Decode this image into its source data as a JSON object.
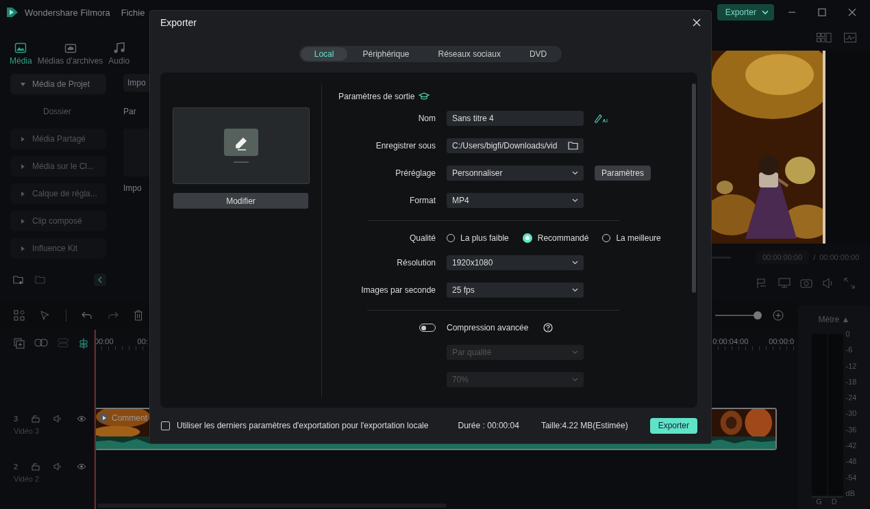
{
  "app": {
    "title": "Wondershare Filmora",
    "menu": [
      "Fichie"
    ],
    "export_button": "Exporter"
  },
  "media_tabs": [
    {
      "label": "Média",
      "selected": true
    },
    {
      "label": "Médias d'archives",
      "selected": false
    },
    {
      "label": "Audio",
      "selected": false
    }
  ],
  "sidebar": {
    "items": [
      {
        "label": "Média de Projet",
        "expanded": true,
        "children": [
          {
            "label": "Dossier"
          }
        ]
      },
      {
        "label": "Média Partagé",
        "expanded": false
      },
      {
        "label": "Média sur le Cl...",
        "expanded": false
      },
      {
        "label": "Calque de régla...",
        "expanded": false
      },
      {
        "label": "Clip composé",
        "expanded": false
      },
      {
        "label": "Influence Kit",
        "expanded": false
      }
    ]
  },
  "media_area": {
    "import_button": "Impo",
    "sort": "Par",
    "import_label": "Impo"
  },
  "preview": {
    "kind": "picture",
    "current_time": "00:00:00:00",
    "separator": "/",
    "total_time": "00:00:00:00"
  },
  "timeline": {
    "ruler_left": [
      "00:00",
      "00:"
    ],
    "ruler_right": [
      "0:00:04:00",
      "00:00:0"
    ],
    "tracks": [
      {
        "number": "3",
        "name": "Vidéo 3",
        "clip": "Comment"
      },
      {
        "number": "2",
        "name": "Vidéo 2"
      }
    ]
  },
  "meter": {
    "title": "Mètre",
    "sort_icon": "▲",
    "scale": [
      "0",
      "-6",
      "-12",
      "-18",
      "-24",
      "-30",
      "-36",
      "-42",
      "-48",
      "-54",
      "dB"
    ],
    "channels": [
      "G",
      "D"
    ]
  },
  "dialog": {
    "title": "Exporter",
    "tabs": [
      {
        "label": "Local",
        "selected": true
      },
      {
        "label": "Périphérique",
        "selected": false
      },
      {
        "label": "Réseaux sociaux",
        "selected": false
      },
      {
        "label": "DVD",
        "selected": false
      }
    ],
    "modify_button": "Modifier",
    "section_title": "Paramètres de sortie",
    "fields": [
      {
        "kind": "text",
        "label": "Nom",
        "value": "Sans titre 4"
      },
      {
        "kind": "path",
        "label": "Enregistrer sous",
        "value": "C:/Users/bigfi/Downloads/vid"
      },
      {
        "kind": "select",
        "label": "Préréglage",
        "value": "Personnaliser",
        "button": "Paramètres"
      },
      {
        "kind": "select",
        "label": "Format",
        "value": "MP4"
      }
    ],
    "quality": {
      "label": "Qualité",
      "options": [
        {
          "label": "La plus faible",
          "selected": false
        },
        {
          "label": "Recommandé",
          "selected": true
        },
        {
          "label": "La meilleure",
          "selected": false
        }
      ]
    },
    "fields2": [
      {
        "kind": "select",
        "label": "Résolution",
        "value": "1920x1080"
      },
      {
        "kind": "select",
        "label": "Images par seconde",
        "value": "25 fps"
      }
    ],
    "compression": {
      "label": "Compression avancée",
      "on": false,
      "mode": "Par qualité",
      "amount": "70%"
    },
    "use_last": {
      "label": "Utiliser les derniers paramètres d'exportation pour l'exportation locale",
      "checked": false
    },
    "duration": "Durée : 00:00:04",
    "size": "Taille:4.22 MB(Estimée)",
    "export_button": "Exporter"
  }
}
